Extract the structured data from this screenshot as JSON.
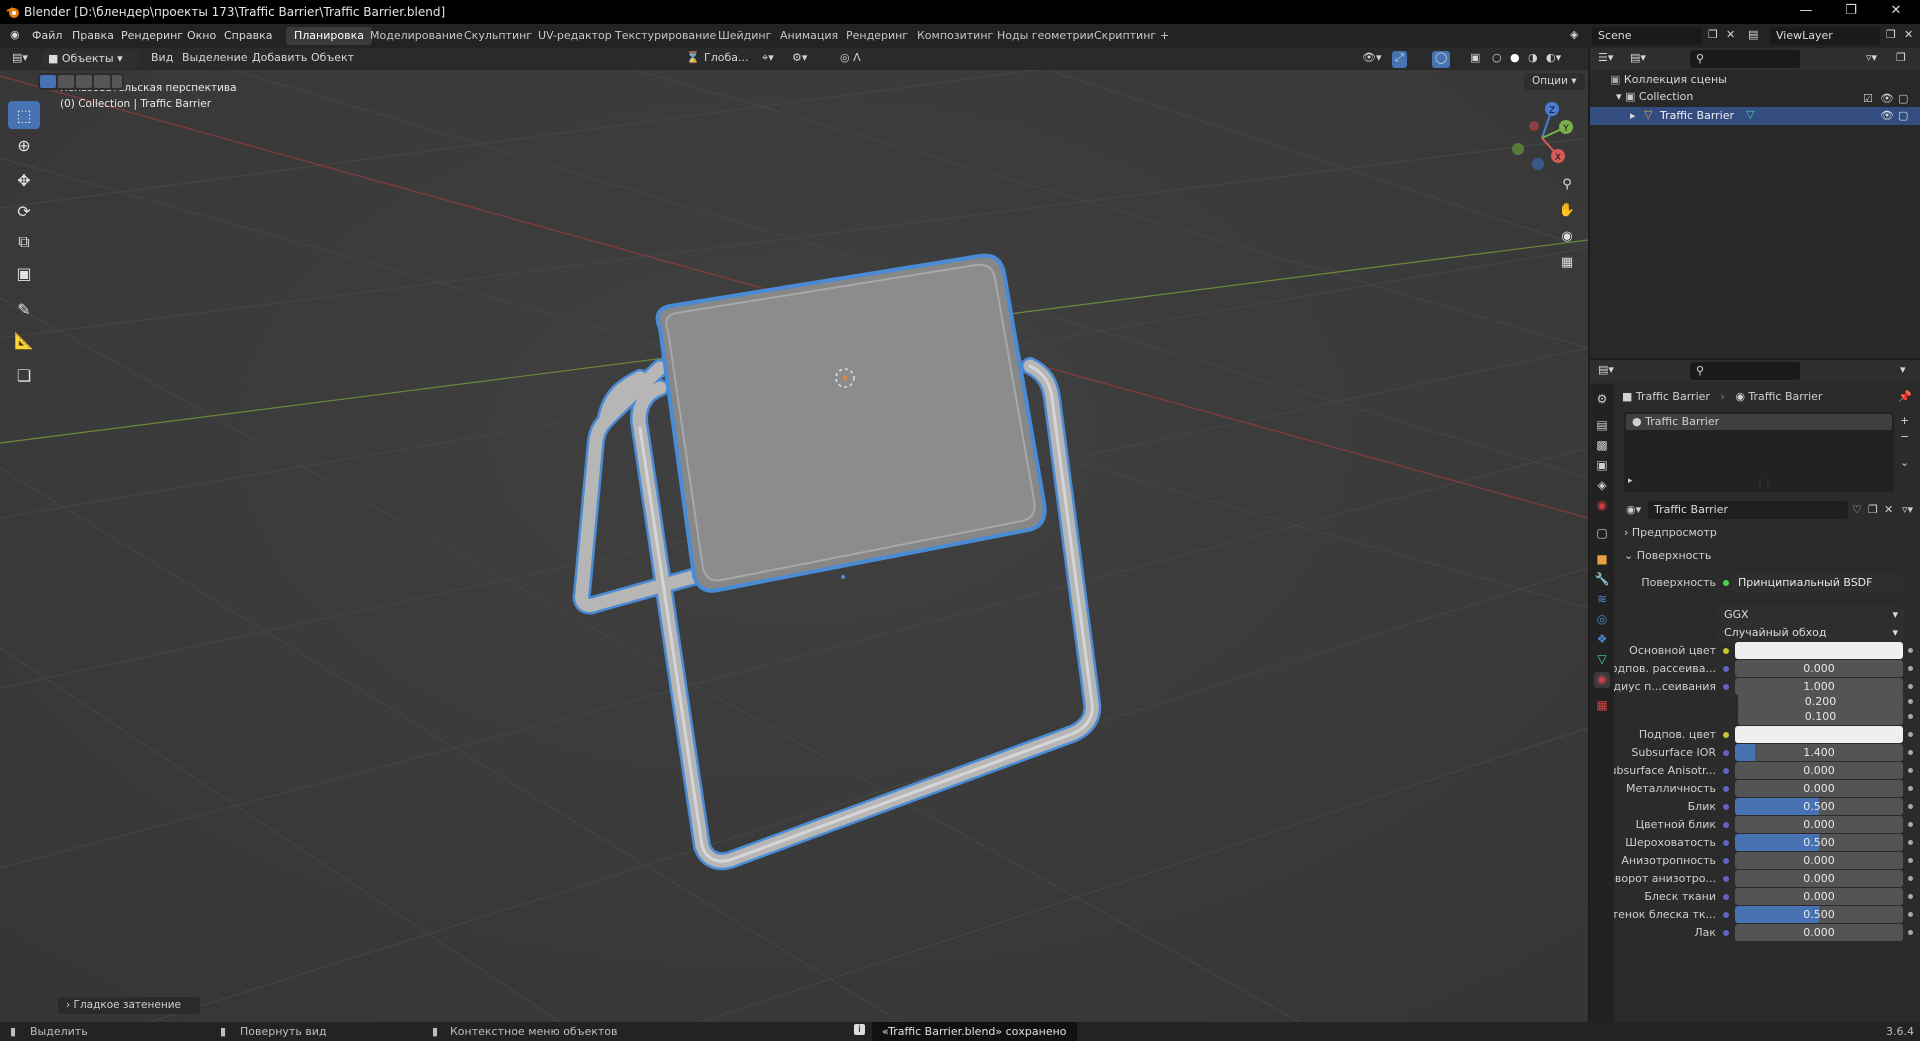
{
  "window": {
    "title": "Blender [D:\\блендер\\проекты 173\\Traffic Barrier\\Traffic Barrier.blend]",
    "controls": [
      "minimize",
      "restore",
      "close"
    ]
  },
  "menu": {
    "items": [
      "Файл",
      "Правка",
      "Рендеринг",
      "Окно",
      "Справка"
    ],
    "workspaces": [
      "Планировка",
      "Моделирование",
      "Скульптинг",
      "UV-редактор",
      "Текстурирование",
      "Шейдинг",
      "Анимация",
      "Рендеринг",
      "Композитинг",
      "Ноды геометрии",
      "Скриптинг"
    ],
    "active_workspace": "Планировка",
    "add_tab": "+",
    "scene": "Scene",
    "view_layer": "ViewLayer"
  },
  "viewport_header": {
    "mode": "Объекты",
    "menus": [
      "Вид",
      "Выделение",
      "Добавить",
      "Объект"
    ],
    "transform_orientation": "Глоба...",
    "options": "Опции"
  },
  "viewport": {
    "overlay_line1": "Пользовательская перспектива",
    "overlay_line2": "(0) Collection | Traffic Barrier",
    "last_operator": "Гладкое затенение",
    "gizmo_axes": [
      "X",
      "Y",
      "Z"
    ],
    "colors": {
      "background": "#3d3d3d",
      "selection": "#4a8bd6",
      "object": "#8a8a8a"
    }
  },
  "outliner": {
    "root": "Коллекция сцены",
    "collection": "Collection",
    "object": "Traffic Barrier"
  },
  "properties": {
    "breadcrumb": [
      "Traffic Barrier",
      "Traffic Barrier"
    ],
    "material_slot": "Traffic Barrier",
    "material_name": "Traffic Barrier",
    "panels": {
      "preview": "Предпросмотр",
      "surface": "Поверхность"
    },
    "surface_label": "Поверхность",
    "surface_shader": "Принципиальный BSDF",
    "distribution": "GGX",
    "subsurface_method": "Случайный обход",
    "rows": [
      {
        "label": "Основной цвет",
        "value": "",
        "kind": "color",
        "fill": 0
      },
      {
        "label": "Подпов. рассеива...",
        "value": "0.000",
        "kind": "num",
        "fill": 0
      },
      {
        "label": "Радиус п...сеивания",
        "value": "1.000",
        "kind": "num",
        "fill": 0
      },
      {
        "label": "",
        "value": "0.200",
        "kind": "num",
        "fill": 0
      },
      {
        "label": "",
        "value": "0.100",
        "kind": "num",
        "fill": 0
      },
      {
        "label": "Подпов. цвет",
        "value": "",
        "kind": "color",
        "fill": 0
      },
      {
        "label": "Subsurface IOR",
        "value": "1.400",
        "kind": "num",
        "fill": 0.12
      },
      {
        "label": "Subsurface Anisotr...",
        "value": "0.000",
        "kind": "num",
        "fill": 0
      },
      {
        "label": "Металличность",
        "value": "0.000",
        "kind": "num",
        "fill": 0
      },
      {
        "label": "Блик",
        "value": "0.500",
        "kind": "num",
        "fill": 0.5
      },
      {
        "label": "Цветной блик",
        "value": "0.000",
        "kind": "num",
        "fill": 0
      },
      {
        "label": "Шероховатость",
        "value": "0.500",
        "kind": "num",
        "fill": 0.5
      },
      {
        "label": "Анизотропность",
        "value": "0.000",
        "kind": "num",
        "fill": 0
      },
      {
        "label": "Поворот анизотро...",
        "value": "0.000",
        "kind": "num",
        "fill": 0
      },
      {
        "label": "Блеск ткани",
        "value": "0.000",
        "kind": "num",
        "fill": 0
      },
      {
        "label": "Оттенок блеска тк...",
        "value": "0.500",
        "kind": "num",
        "fill": 0.5
      },
      {
        "label": "Лак",
        "value": "0.000",
        "kind": "num",
        "fill": 0
      }
    ]
  },
  "statusbar": {
    "select": "Выделить",
    "rotate": "Повернуть вид",
    "context": "Контекстное меню объектов",
    "message": "«Traffic Barrier.blend» сохранено",
    "version": "3.6.4"
  }
}
